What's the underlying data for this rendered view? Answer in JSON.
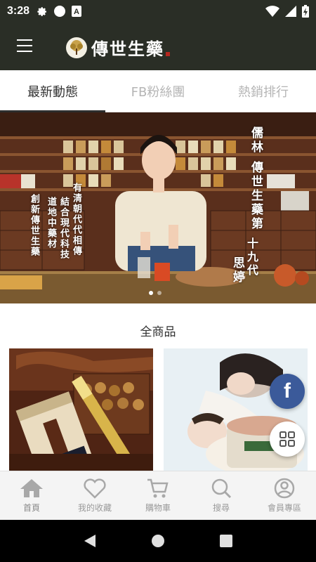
{
  "status_bar": {
    "time": "3:28",
    "icons": [
      "settings-icon",
      "circle-icon",
      "a-box-icon",
      "wifi-icon",
      "signal-icon",
      "battery-charging-icon"
    ]
  },
  "app_bar": {
    "menu_icon": "hamburger-menu-icon",
    "logo_text": "傳世生藥"
  },
  "tabs": [
    {
      "label": "最新動態",
      "active": true
    },
    {
      "label": "FB粉絲團",
      "active": false
    },
    {
      "label": "熱銷排行",
      "active": false
    }
  ],
  "banner": {
    "text_right_1": "儒林 傳世生藥第",
    "text_right_2": "十九代",
    "text_right_3": "思婷",
    "text_left_1": "有清朝代代相傳",
    "text_left_2": "結合現代科技",
    "text_left_3": "道地中藥材",
    "text_left_4": "創新傳世生藥",
    "slide_count": 2,
    "active_slide": 0
  },
  "section": {
    "title": "全商品"
  },
  "floating": {
    "facebook_label": "f",
    "grid_icon": "grid-icon"
  },
  "bottom_nav": [
    {
      "label": "首頁",
      "icon": "home-icon"
    },
    {
      "label": "我的收藏",
      "icon": "heart-icon"
    },
    {
      "label": "購物車",
      "icon": "cart-icon"
    },
    {
      "label": "搜尋",
      "icon": "search-icon"
    },
    {
      "label": "會員專區",
      "icon": "user-icon"
    }
  ],
  "colors": {
    "app_bar": "#2a2e26",
    "facebook": "#3b5a9a",
    "nav_background": "#f4f4f4",
    "nav_icon": "#a8a8a8"
  }
}
